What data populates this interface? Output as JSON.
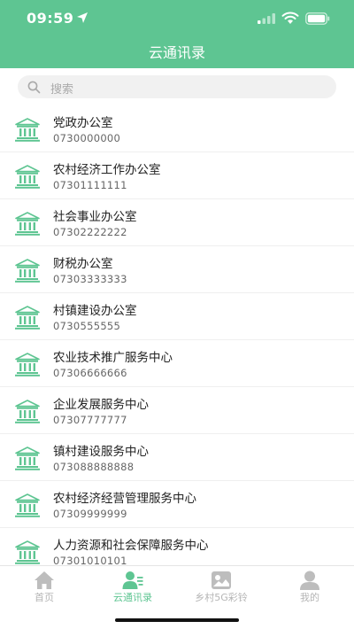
{
  "status_bar": {
    "time": "09:59"
  },
  "header": {
    "title": "云通讯录"
  },
  "search": {
    "placeholder": "搜索"
  },
  "contacts": [
    {
      "name": "党政办公室",
      "phone": "0730000000"
    },
    {
      "name": "农村经济工作办公室",
      "phone": "07301111111"
    },
    {
      "name": "社会事业办公室",
      "phone": "07302222222"
    },
    {
      "name": "财税办公室",
      "phone": "07303333333"
    },
    {
      "name": "村镇建设办公室",
      "phone": "0730555555"
    },
    {
      "name": "农业技术推广服务中心",
      "phone": "07306666666"
    },
    {
      "name": "企业发展服务中心",
      "phone": "07307777777"
    },
    {
      "name": "镇村建设服务中心",
      "phone": "073088888888"
    },
    {
      "name": "农村经济经营管理服务中心",
      "phone": "07309999999"
    },
    {
      "name": "人力资源和社会保障服务中心",
      "phone": "07301010101"
    }
  ],
  "tabs": [
    {
      "label": "首页",
      "icon": "home-icon",
      "active": false
    },
    {
      "label": "云通讯录",
      "icon": "contacts-icon",
      "active": true
    },
    {
      "label": "乡村5G彩铃",
      "icon": "ringtone-icon",
      "active": false
    },
    {
      "label": "我的",
      "icon": "profile-icon",
      "active": false
    }
  ],
  "colors": {
    "accent": "#5ec592",
    "inactive": "#b5b5b5"
  }
}
